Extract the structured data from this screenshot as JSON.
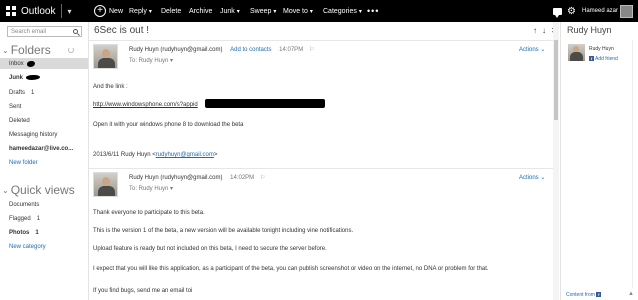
{
  "app": {
    "name": "Outlook"
  },
  "toolbar": {
    "new": "New",
    "reply": "Reply",
    "delete": "Delete",
    "archive": "Archive",
    "junk": "Junk",
    "sweep": "Sweep",
    "move_to": "Move to",
    "categories": "Categories",
    "more": "•••",
    "user_name": "Hameed azar"
  },
  "sidebar": {
    "search_placeholder": "Search email",
    "folders_heading": "Folders",
    "folders": [
      {
        "label": "Inbox"
      },
      {
        "label": "Junk"
      },
      {
        "label": "Drafts",
        "count": "1"
      },
      {
        "label": "Sent"
      },
      {
        "label": "Deleted"
      },
      {
        "label": "Messaging history"
      },
      {
        "label": "hameedazar@live.co..."
      },
      {
        "label": "New folder"
      }
    ],
    "quick_views_heading": "Quick views",
    "quick_views": [
      {
        "label": "Documents"
      },
      {
        "label": "Flagged",
        "count": "1"
      },
      {
        "label": "Photos",
        "count": "1"
      },
      {
        "label": "New category"
      }
    ]
  },
  "message": {
    "subject": "6Sec is out !",
    "nav_icons": [
      "↑",
      "↓",
      "✕"
    ],
    "actions_label": "Actions",
    "first": {
      "sender": "Rudy Huyn (rudyhuyn@gmail.com)",
      "add_to_contacts": "Add to contacts",
      "time": "14:07PM",
      "to": "To: Rudy Huyn",
      "line1": "And the link :",
      "link": "http://www.windowsphone.com/s?appid",
      "line2": "Open it with your windows phone 8 to download the beta",
      "signature_prefix": "2013/6/11 Rudy Huyn <",
      "signature_email": "rudyhuyn@gmail.com",
      "signature_suffix": ">"
    },
    "second": {
      "sender": "Rudy Huyn (rudyhuyn@gmail.com)",
      "time": "14:02PM",
      "to": "To: Rudy Huyn",
      "paragraphs": [
        "Thank everyone to participate to this beta.",
        "This is the version 1 of the beta, a new version will be available tonight including vine notifications.",
        "Upload feature is ready but not included on this beta, I need to secure the server before.",
        "I expect that you will like this application, as a participant of the beta, you can publish screenshot or video on the internet, no DNA or problem for that.",
        "If you find bugs, send me an email toi"
      ]
    }
  },
  "contact": {
    "name": "Rudy Huyn",
    "line1": "Rudy Huyn",
    "add_friend": "Add friend",
    "content_from": "Content from"
  }
}
